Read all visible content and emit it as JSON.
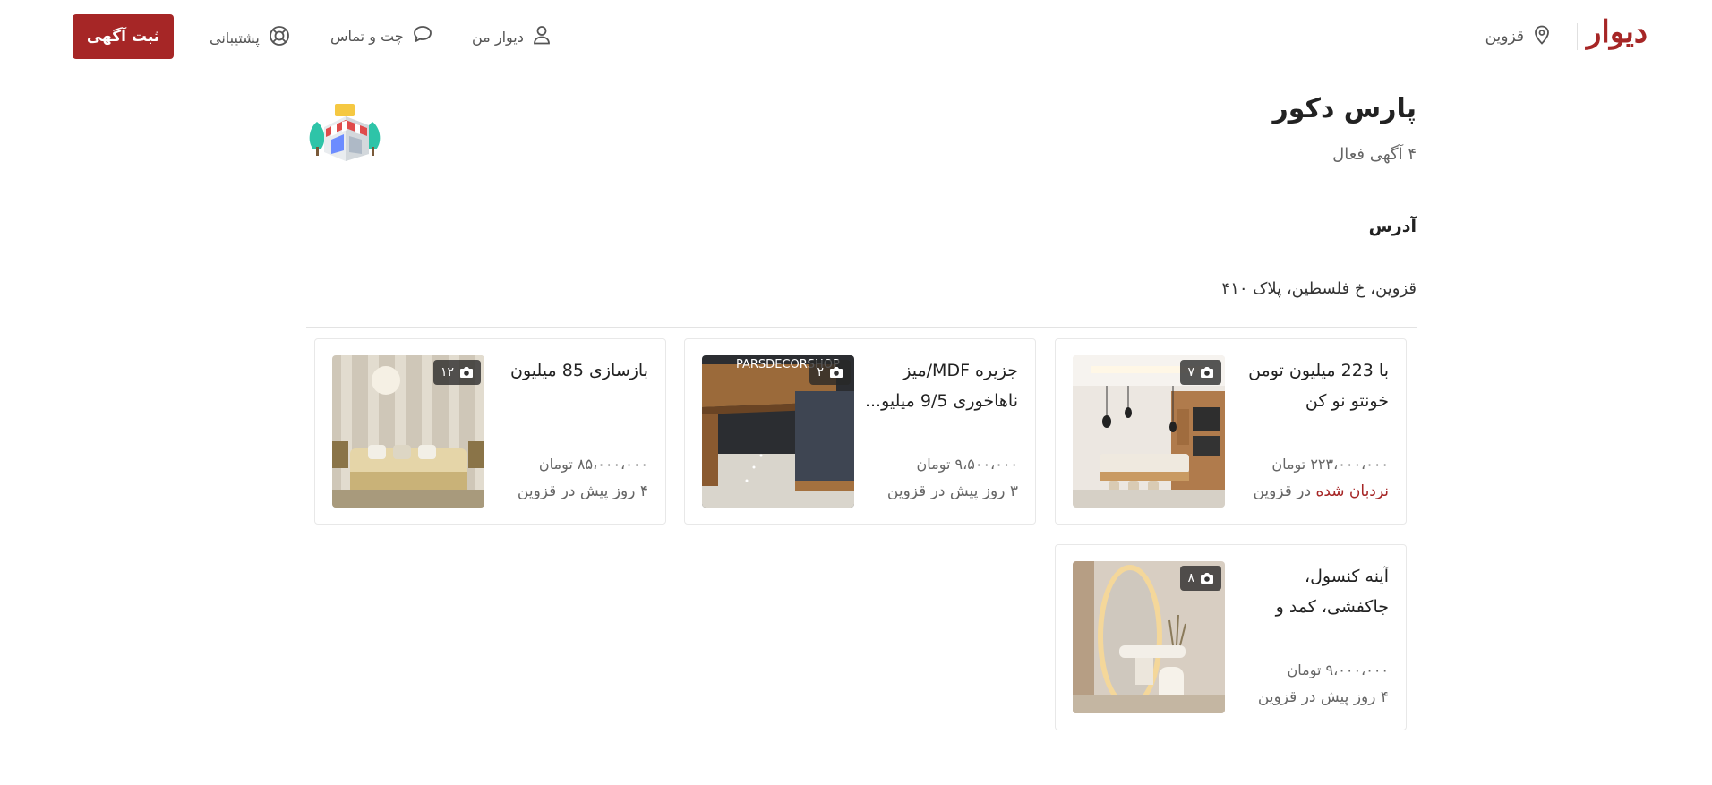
{
  "header": {
    "logo_text": "دیوار",
    "city": "قزوین",
    "nav": {
      "my_divar": "دیوار من",
      "chat": "چت و تماس",
      "support": "پشتیبانی"
    },
    "post_button": "ثبت آگهی"
  },
  "store": {
    "name": "پارس دکور",
    "active_ads": "۴ آگهی فعال",
    "address_title": "آدرس",
    "address": "قزوین، خ فلسطین، پلاک ۴۱۰"
  },
  "listings": [
    {
      "title": "با 223 میلیون تومن خونتو نو کن",
      "price": "۲۲۳،۰۰۰،۰۰۰ تومان",
      "promoted": "نردبان شده",
      "meta": " در قزوین",
      "photos": "۷"
    },
    {
      "title": "جزیره MDF/میز ناهاخوری 9/5 میلیو...",
      "price": "۹،۵۰۰،۰۰۰ تومان",
      "meta": "۳ روز پیش در قزوین",
      "photos": "۲",
      "watermark": "PARSDECORSHOP"
    },
    {
      "title": "بازسازی 85 میلیون",
      "price": "۸۵،۰۰۰،۰۰۰ تومان",
      "meta": "۴ روز پیش در قزوین",
      "photos": "۱۲"
    },
    {
      "title": "آینه کنسول، جاکفشی، کمد و کابینت متری ...",
      "price": "۹،۰۰۰،۰۰۰ تومان",
      "meta": "۴ روز پیش در قزوین",
      "photos": "۸"
    }
  ],
  "icons": {
    "location": "location-pin-icon",
    "user": "user-icon",
    "chat": "chat-bubble-icon",
    "support": "lifebuoy-icon",
    "camera": "camera-icon"
  },
  "colors": {
    "brand": "#a62626",
    "text_muted": "#666666",
    "border": "#e8e8e8"
  }
}
